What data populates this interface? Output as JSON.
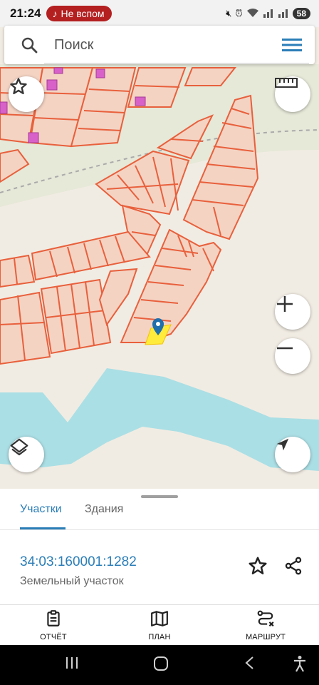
{
  "status_bar": {
    "time": "21:24",
    "notification_pill": "Не вспом",
    "battery": "58"
  },
  "search": {
    "placeholder": "Поиск"
  },
  "bottom_sheet": {
    "tabs": [
      "Участки",
      "Здания"
    ],
    "active_tab": "Участки",
    "parcel_number": "34:03:160001:1282",
    "parcel_type": "Земельный участок"
  },
  "bottom_nav": {
    "report": "ОТЧЁТ",
    "plan": "ПЛАН",
    "route": "МАРШРУТ"
  },
  "colors": {
    "accent": "#2b7eb8",
    "parcel_fill": "#f4d3c3",
    "parcel_stroke": "#e8603c",
    "water": "#aadfe5",
    "selected_parcel": "#ffeb3b",
    "building": "#d861c9"
  },
  "icons": [
    "search-icon",
    "menu-icon",
    "star-icon",
    "ruler-icon",
    "zoom-in-icon",
    "zoom-out-icon",
    "layers-icon",
    "locate-icon",
    "share-icon",
    "report-icon",
    "map-icon",
    "route-icon"
  ]
}
